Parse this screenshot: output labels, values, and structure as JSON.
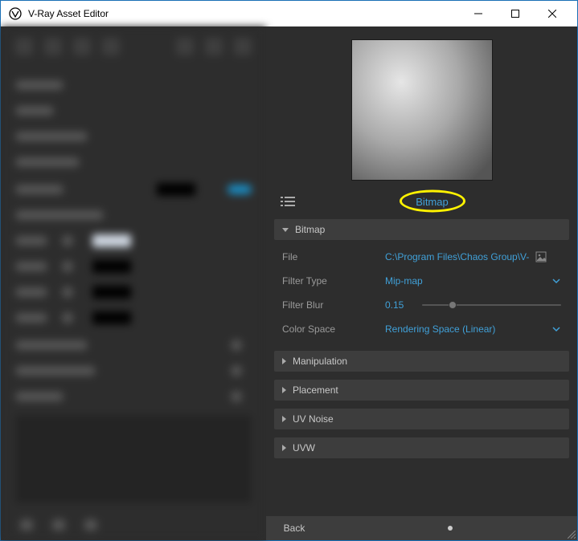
{
  "window": {
    "title": "V-Ray Asset Editor"
  },
  "tab": {
    "name": "Bitmap"
  },
  "sections": {
    "bitmap": {
      "title": "Bitmap",
      "file_label": "File",
      "file_value": "C:\\Program Files\\Chaos Group\\V-Ra...",
      "filter_type_label": "Filter Type",
      "filter_type_value": "Mip-map",
      "filter_blur_label": "Filter Blur",
      "filter_blur_value": "0.15",
      "color_space_label": "Color Space",
      "color_space_value": "Rendering Space (Linear)"
    },
    "manipulation": {
      "title": "Manipulation"
    },
    "placement": {
      "title": "Placement"
    },
    "uv_noise": {
      "title": "UV Noise"
    },
    "uvw": {
      "title": "UVW"
    }
  },
  "bottom": {
    "back": "Back"
  }
}
